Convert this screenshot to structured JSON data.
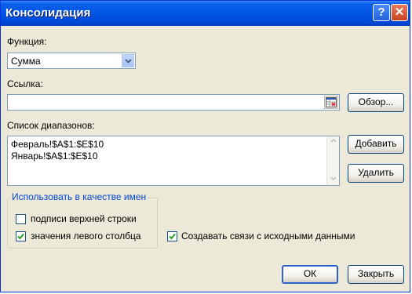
{
  "window": {
    "title": "Консолидация"
  },
  "function": {
    "label": "Функция:",
    "value": "Сумма"
  },
  "reference": {
    "label": "Ссылка:",
    "value": "",
    "browse_label": "Обзор..."
  },
  "ranges": {
    "label": "Список диапазонов:",
    "items": [
      "Февраль!$A$1:$E$10",
      "Январь!$A$1:$E$10"
    ],
    "add_label": "Добавить",
    "delete_label": "Удалить"
  },
  "use_labels": {
    "title": "Использовать в качестве имен",
    "top_row": {
      "label": "подписи верхней строки",
      "checked": false
    },
    "left_column": {
      "label": "значения левого столбца",
      "checked": true
    }
  },
  "links": {
    "label": "Создавать связи с исходными данными",
    "checked": true
  },
  "buttons": {
    "ok": "ОК",
    "close": "Закрыть"
  },
  "icons": {
    "help": "help-icon",
    "close": "close-icon",
    "dropdown": "chevron-down-icon",
    "collapse": "collapse-dialog-icon"
  }
}
